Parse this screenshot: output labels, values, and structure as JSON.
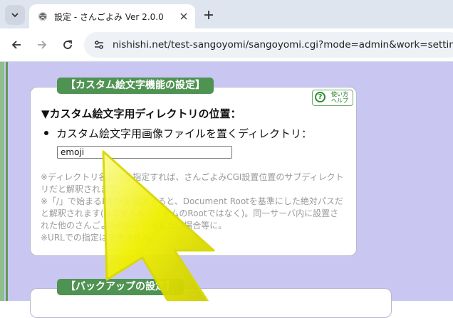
{
  "browser": {
    "tab_title": "設定 - さんごよみ Ver 2.0.0",
    "url": "nishishi.net/test-sangoyomi/sangoyomi.cgi?mode=admin&work=setting"
  },
  "page": {
    "section1": {
      "label": "【カスタム絵文字機能の設定】",
      "help": {
        "line1": "使い方",
        "line2": "ヘルプ"
      },
      "heading": "▼カスタム絵文字用ディレクトリの位置：",
      "item_label": "カスタム絵文字用画像ファイルを置くディレクトリ：",
      "input_value": "emoji",
      "notes": [
        "※ディレクトリ名だけを指定すれば、さんごよみCGI設置位置のサブディレクトリだと解釈されます。",
        "※「/」で始まるPATHを指定すると、Document Rootを基準にした絶対パスだと解釈されます(※ファイルシステムのRootではなく)。同一サーバ内に設置された他のさんごよみCGIと共有したい場合等に。",
        "※URLでの指定はできません。"
      ]
    },
    "section2": {
      "label": "【バックアップの設定】"
    }
  },
  "colors": {
    "page_bg": "#c9c7f2",
    "label_green": "#4f9353",
    "cursor_yellow": "#f0f000"
  },
  "cursor": {
    "icon": "mouse-pointer-icon"
  }
}
